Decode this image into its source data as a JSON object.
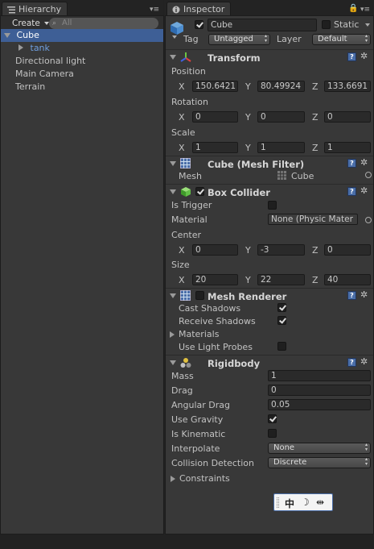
{
  "hierarchy": {
    "tab_label": "Hierarchy",
    "create_label": "Create",
    "search_placeholder": "All",
    "items": [
      {
        "label": "Cube"
      },
      {
        "label": "tank"
      },
      {
        "label": "Directional light"
      },
      {
        "label": "Main Camera"
      },
      {
        "label": "Terrain"
      }
    ]
  },
  "inspector": {
    "tab_label": "Inspector",
    "object_name": "Cube",
    "static_label": "Static",
    "tag_label": "Tag",
    "tag_value": "Untagged",
    "layer_label": "Layer",
    "layer_value": "Default",
    "transform": {
      "title": "Transform",
      "position_label": "Position",
      "position": {
        "x": "150.6421",
        "y": "80.49924",
        "z": "133.6691"
      },
      "rotation_label": "Rotation",
      "rotation": {
        "x": "0",
        "y": "0",
        "z": "0"
      },
      "scale_label": "Scale",
      "scale": {
        "x": "1",
        "y": "1",
        "z": "1"
      }
    },
    "axis": {
      "x": "X",
      "y": "Y",
      "z": "Z"
    },
    "mesh_filter": {
      "title": "Cube (Mesh Filter)",
      "mesh_label": "Mesh",
      "mesh_value": "Cube"
    },
    "box_collider": {
      "title": "Box Collider",
      "is_trigger_label": "Is Trigger",
      "material_label": "Material",
      "material_value": "None (Physic Mater",
      "center_label": "Center",
      "center": {
        "x": "0",
        "y": "-3",
        "z": "0"
      },
      "size_label": "Size",
      "size": {
        "x": "20",
        "y": "22",
        "z": "40"
      }
    },
    "mesh_renderer": {
      "title": "Mesh Renderer",
      "cast_shadows_label": "Cast Shadows",
      "receive_shadows_label": "Receive Shadows",
      "materials_label": "Materials",
      "light_probes_label": "Use Light Probes"
    },
    "rigidbody": {
      "title": "Rigidbody",
      "mass_label": "Mass",
      "mass": "1",
      "drag_label": "Drag",
      "drag": "0",
      "angular_drag_label": "Angular Drag",
      "angular_drag": "0.05",
      "use_gravity_label": "Use Gravity",
      "is_kinematic_label": "Is Kinematic",
      "interpolate_label": "Interpolate",
      "interpolate_value": "None",
      "collision_label": "Collision Detection",
      "collision_value": "Discrete",
      "constraints_label": "Constraints"
    }
  },
  "ime_toolbar": {
    "lang": "中"
  },
  "colors": {
    "selection": "#3e5f96",
    "panel": "#383838",
    "accent_blue": "#4a6ea8"
  }
}
